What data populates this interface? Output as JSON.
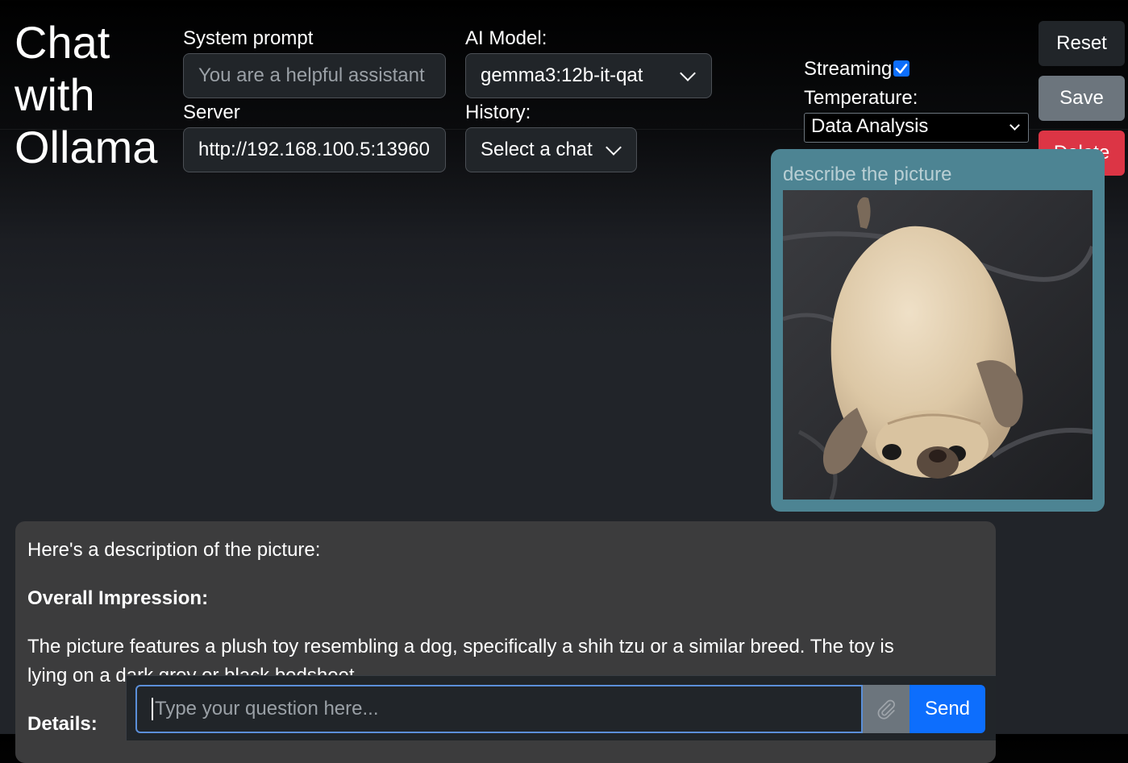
{
  "app": {
    "title_lines": [
      "Chat",
      "with",
      "Ollama"
    ]
  },
  "settings": {
    "system_prompt_label": "System prompt",
    "system_prompt_placeholder": "You are a helpful assistant",
    "model_label": "AI Model:",
    "model_value": "gemma3:12b-it-qat",
    "server_label": "Server",
    "server_value": "http://192.168.100.5:13960",
    "history_label": "History:",
    "history_value": "Select a chat",
    "streaming_label": "Streaming",
    "streaming_checked": true,
    "temperature_label": "Temperature:",
    "temperature_value": "Data Analysis"
  },
  "actions": {
    "reset": "Reset",
    "save": "Save",
    "delete": "Delete"
  },
  "conversation": {
    "user_message": "describe the picture",
    "assistant": {
      "intro": "Here's a description of the picture:",
      "heading1": "Overall Impression:",
      "paragraph1": "The picture features a plush toy resembling a dog, specifically a shih tzu or a similar breed. The toy is lying on a dark grey or black bedsheet.",
      "heading2": "Details:"
    }
  },
  "composer": {
    "placeholder": "Type your question here...",
    "attach_icon": "paperclip-icon",
    "send": "Send"
  },
  "colors": {
    "accent": "#0d6efd",
    "delete": "#dc3545",
    "save": "#6c757d",
    "user_bubble": "#4d8493"
  }
}
